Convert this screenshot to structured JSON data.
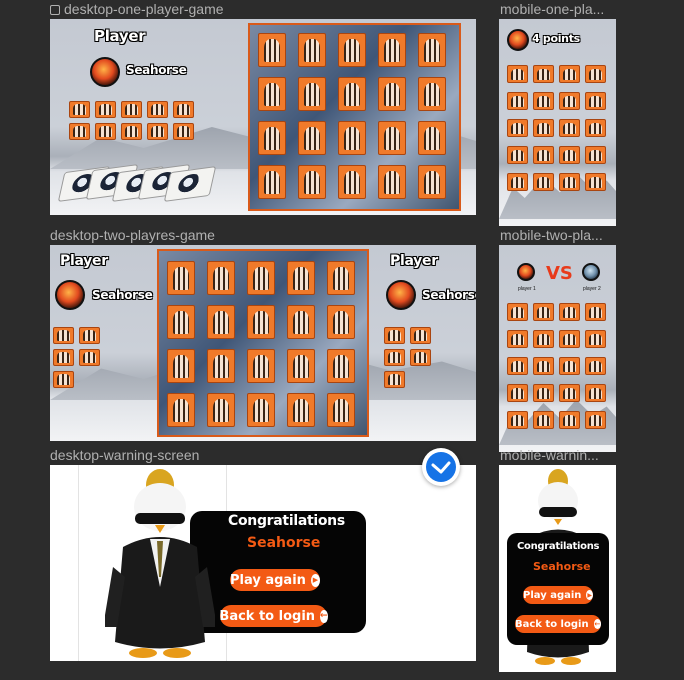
{
  "frames": {
    "desktop_one": {
      "label": "desktop-one-player-game",
      "player_heading": "Player",
      "player_name": "Seahorse"
    },
    "mobile_one": {
      "label": "mobile-one-pla...",
      "points": "4 points"
    },
    "desktop_two": {
      "label": "desktop-two-playres-game",
      "left_heading": "Player",
      "left_name": "Seahorse",
      "right_heading": "Player",
      "right_name": "Seahorse"
    },
    "mobile_two": {
      "label": "mobile-two-pla...",
      "vs": "VS",
      "p1": "player 1",
      "p2": "player 2"
    },
    "desktop_warning": {
      "label": "desktop-warning-screen",
      "title": "Congratilations",
      "name": "Seahorse",
      "play_again": "Play again",
      "back_to_login": "Back to login"
    },
    "mobile_warning": {
      "label": "mobile-warnin...",
      "title": "Congratilations",
      "name": "Seahorse",
      "play_again": "Play again",
      "back_to_login": "Back to login"
    }
  },
  "icons": {
    "frame_icon": "frame-icon",
    "badge": "check-badge-icon",
    "avatar": "seahorse-avatar-icon",
    "play": "play-icon",
    "back": "back-arrow-icon"
  },
  "colors": {
    "accent": "#f35a14",
    "card": "#f07a2a",
    "board_border": "#d95a1a",
    "canvas": "#2c2c2c"
  }
}
